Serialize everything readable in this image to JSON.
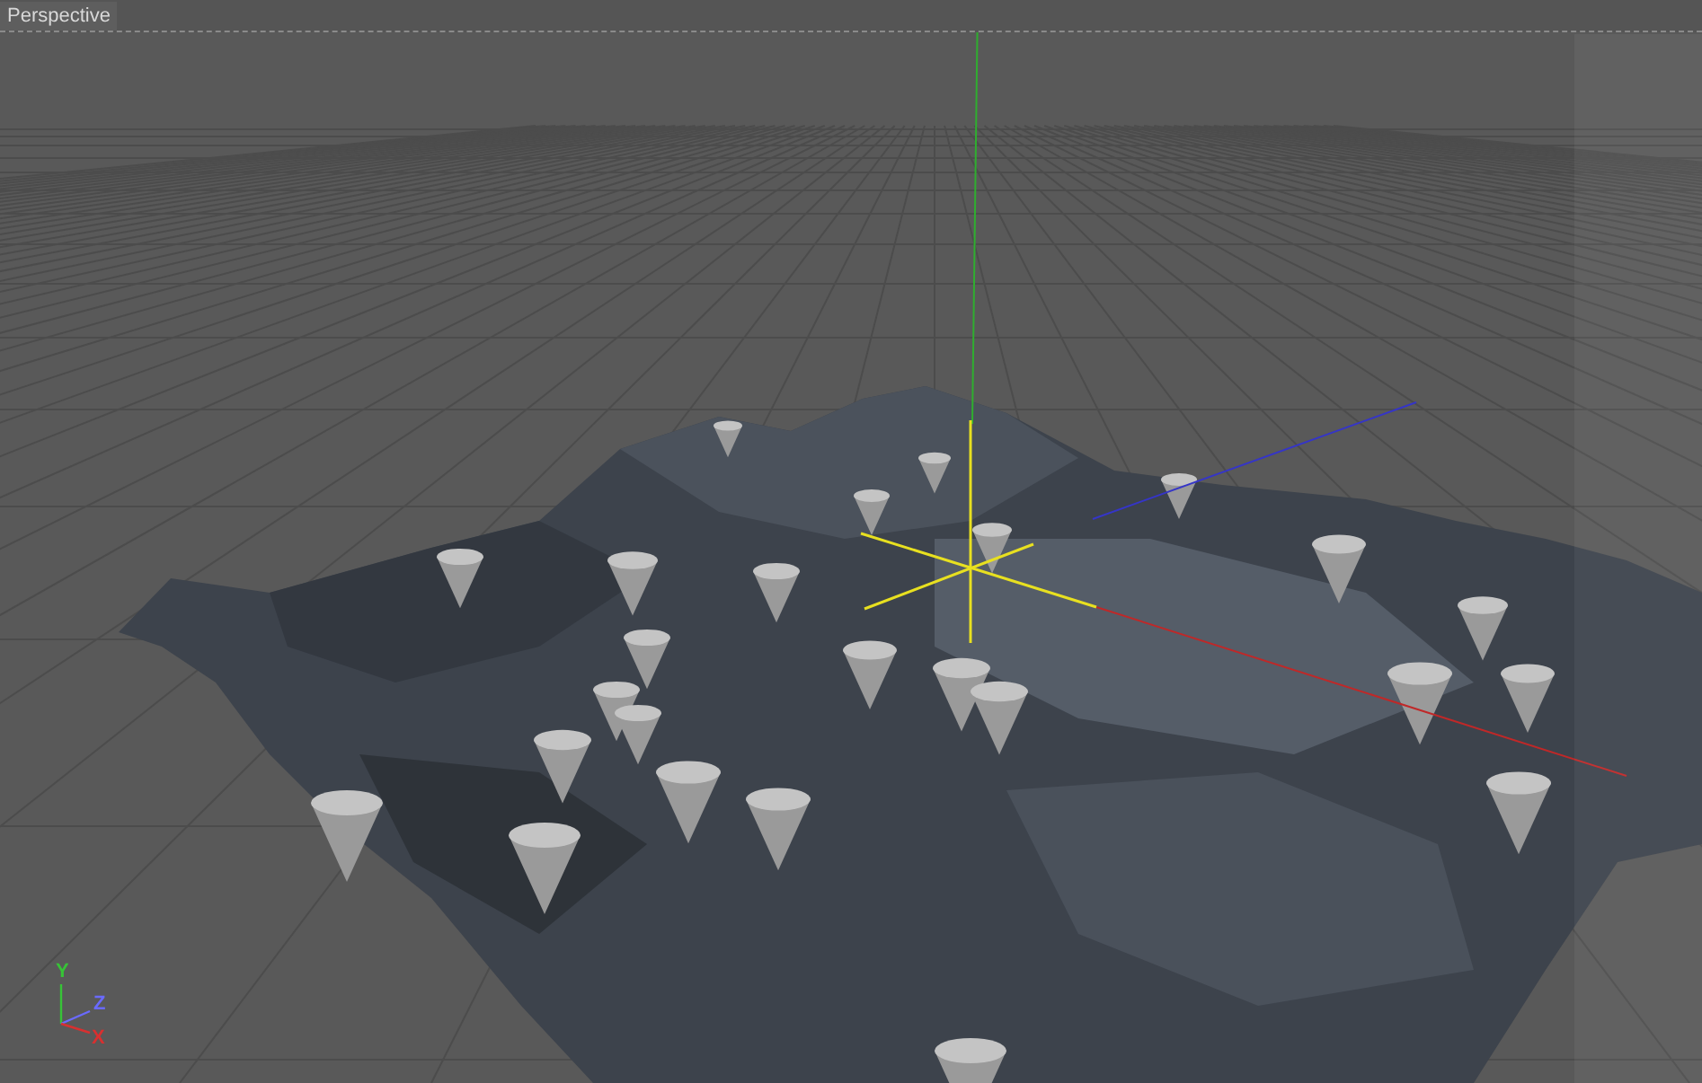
{
  "viewport": {
    "title": "Perspective"
  },
  "gizmo": {
    "axes": [
      {
        "label": "Y",
        "color": "#37c337"
      },
      {
        "label": "Z",
        "color": "#6a6aff"
      },
      {
        "label": "X",
        "color": "#d83030"
      }
    ]
  }
}
